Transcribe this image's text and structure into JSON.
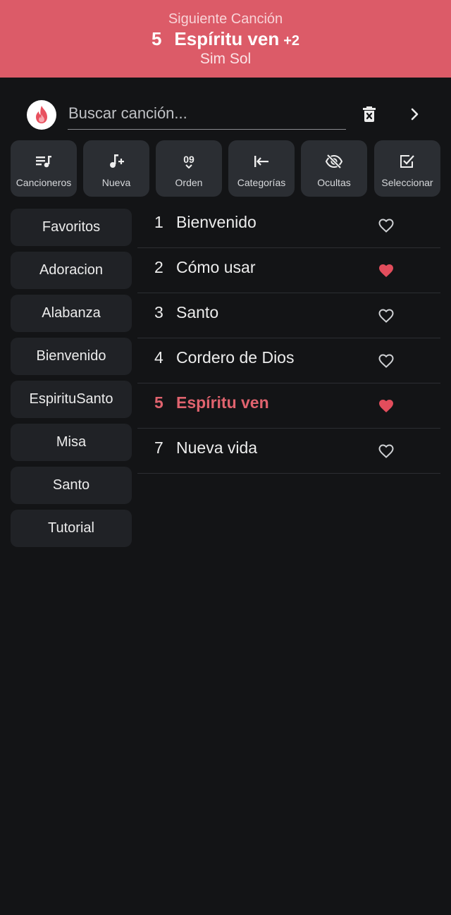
{
  "next_song": {
    "label": "Siguiente Canción",
    "number": "5",
    "title": "Espíritu ven",
    "transpose": "+2",
    "key": "Sim Sol"
  },
  "search": {
    "placeholder": "Buscar canción..."
  },
  "toolbar": {
    "cancioneros": "Cancioneros",
    "nueva": "Nueva",
    "orden": "Orden",
    "orden_icon_text": "09",
    "categorias": "Categorías",
    "ocultas": "Ocultas",
    "seleccionar": "Seleccionar"
  },
  "categories": [
    "Favoritos",
    "Adoracion",
    "Alabanza",
    "Bienvenido",
    "EspirituSanto",
    "Misa",
    "Santo",
    "Tutorial"
  ],
  "songs": [
    {
      "number": "1",
      "title": "Bienvenido",
      "favorite": false
    },
    {
      "number": "2",
      "title": "Cómo usar",
      "favorite": true
    },
    {
      "number": "3",
      "title": "Santo",
      "favorite": false
    },
    {
      "number": "4",
      "title": "Cordero de Dios",
      "favorite": false
    },
    {
      "number": "5",
      "title": "Espíritu ven",
      "favorite": true
    },
    {
      "number": "7",
      "title": "Nueva vida",
      "favorite": false
    }
  ],
  "colors": {
    "accent": "#dc5b68",
    "background": "#131416",
    "button": "#2b2e33",
    "category": "#202226",
    "heart_filled": "#e24d5c"
  },
  "icons": {
    "logo": "flame-logo-icon",
    "clear": "delete-icon",
    "next": "chevron-right-icon",
    "heart_filled": "heart-filled-icon",
    "heart_outline": "heart-outline-icon"
  }
}
